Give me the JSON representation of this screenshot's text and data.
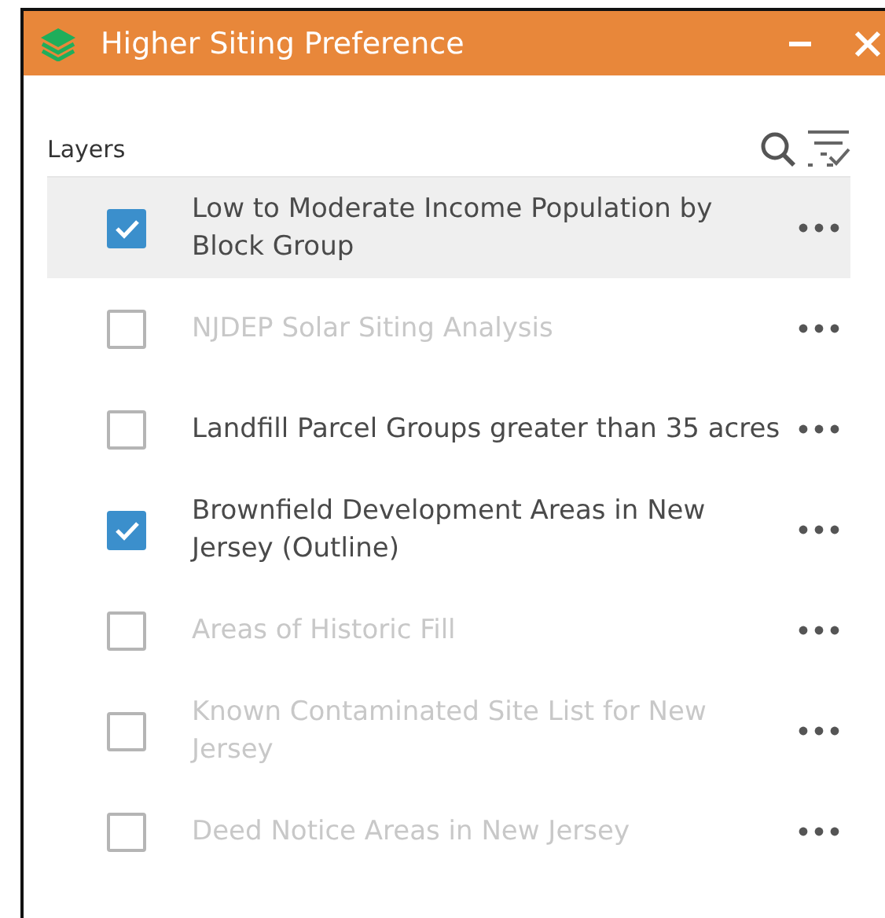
{
  "window": {
    "title": "Higher Siting Preference"
  },
  "panel": {
    "label": "Layers"
  },
  "layers": [
    {
      "name": "Low to Moderate Income Population by Block Group",
      "checked": true,
      "disabled": false,
      "selected": true
    },
    {
      "name": "NJDEP Solar Siting Analysis",
      "checked": false,
      "disabled": true,
      "selected": false
    },
    {
      "name": "Landfill Parcel Groups greater than 35 acres",
      "checked": false,
      "disabled": false,
      "selected": false
    },
    {
      "name": "Brownfield Development Areas in New Jersey (Outline)",
      "checked": true,
      "disabled": false,
      "selected": false
    },
    {
      "name": "Areas of Historic Fill",
      "checked": false,
      "disabled": true,
      "selected": false
    },
    {
      "name": "Known Contaminated Site List for New Jersey",
      "checked": false,
      "disabled": true,
      "selected": false
    },
    {
      "name": "Deed Notice Areas in New Jersey",
      "checked": false,
      "disabled": true,
      "selected": false
    }
  ]
}
